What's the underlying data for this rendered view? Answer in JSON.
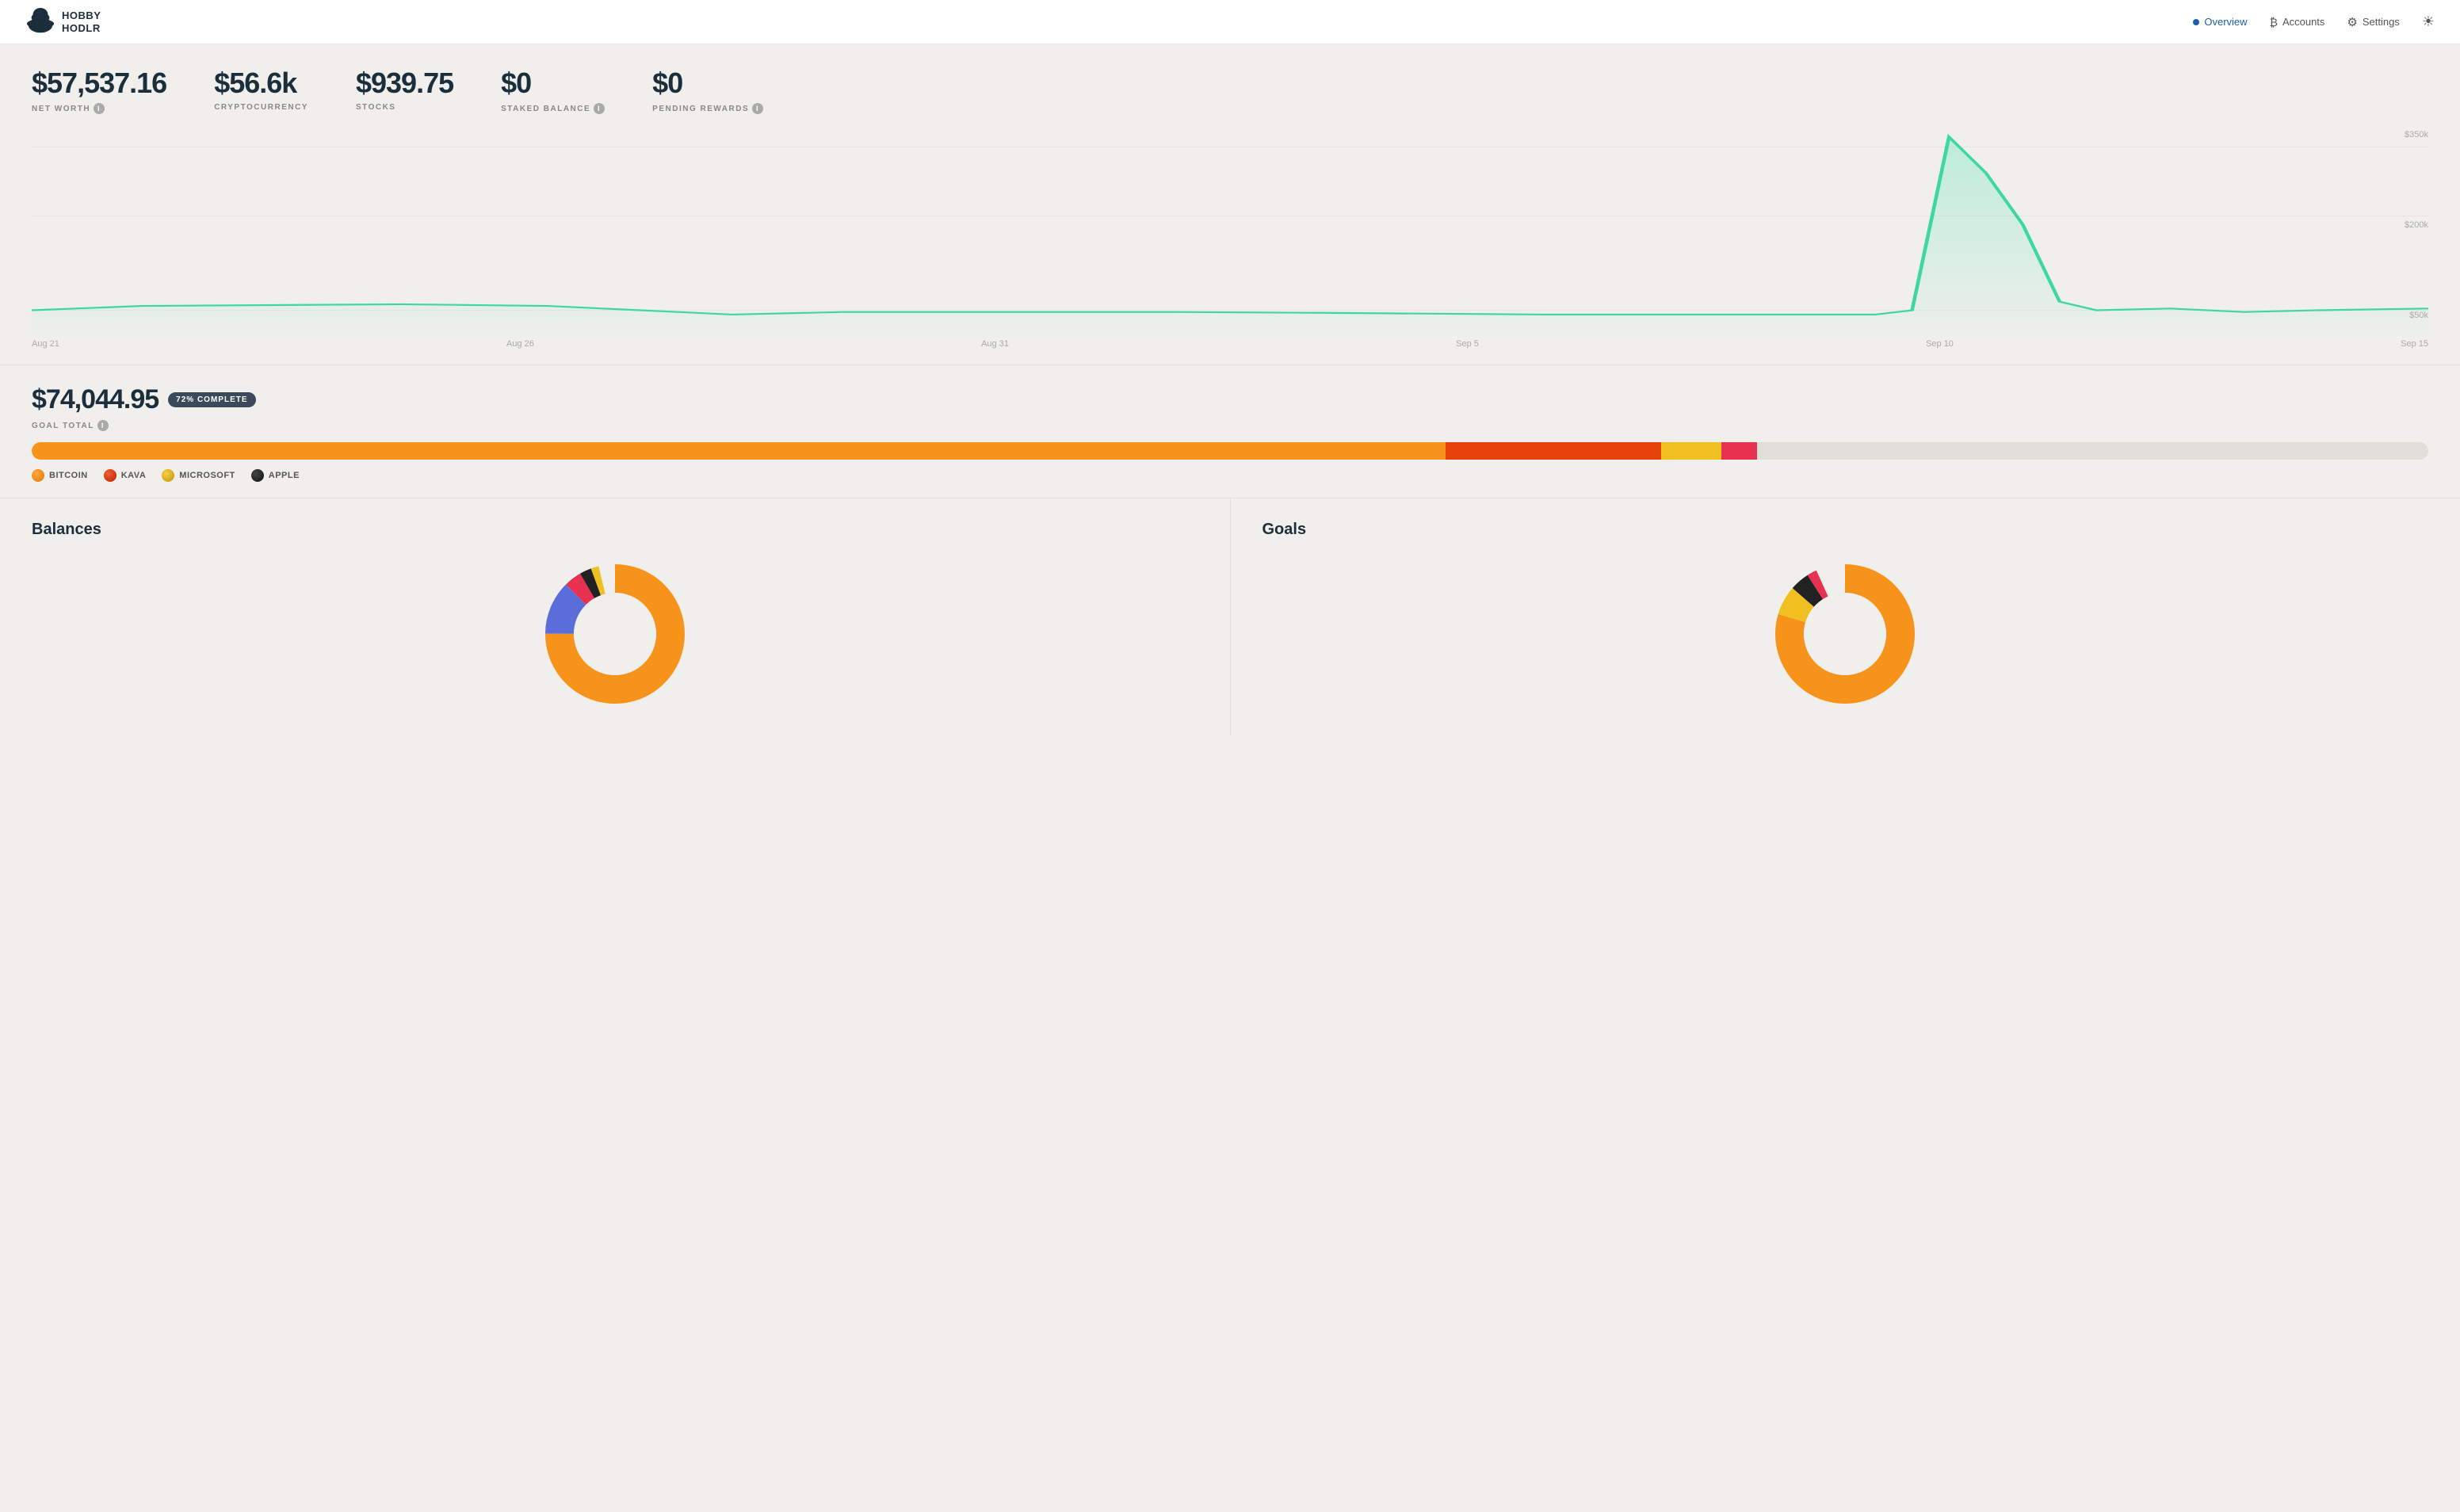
{
  "app": {
    "name_line1": "HOBBY",
    "name_line2": "HODLR"
  },
  "nav": {
    "links": [
      {
        "id": "overview",
        "label": "Overview",
        "active": true,
        "icon": "circle-dot"
      },
      {
        "id": "accounts",
        "label": "Accounts",
        "active": false,
        "icon": "bitcoin"
      },
      {
        "id": "settings",
        "label": "Settings",
        "active": false,
        "icon": "gear"
      }
    ],
    "theme_icon": "sun"
  },
  "stats": {
    "net_worth": {
      "value": "$57,537.16",
      "label": "NET WORTH",
      "has_info": true
    },
    "cryptocurrency": {
      "value": "$56.6k",
      "label": "CRYPTOCURRENCY",
      "has_info": false
    },
    "stocks": {
      "value": "$939.75",
      "label": "STOCKS",
      "has_info": false
    },
    "staked_balance": {
      "value": "$0",
      "label": "STAKED BALANCE",
      "has_info": true
    },
    "pending_rewards": {
      "value": "$0",
      "label": "PENDING REWARDS",
      "has_info": true
    }
  },
  "chart": {
    "x_labels": [
      "Aug 21",
      "Aug 26",
      "Aug 31",
      "Sep 5",
      "Sep 10",
      "Sep 15"
    ],
    "y_labels": [
      "$350k",
      "$200k",
      "$50k"
    ],
    "peak_date": "Sep 10"
  },
  "goal": {
    "amount": "$74,044.95",
    "badge": "72% COMPLETE",
    "label": "GOAL TOTAL",
    "has_info": true,
    "bar_segments": [
      {
        "id": "bitcoin",
        "pct": 58,
        "color": "#f7931a"
      },
      {
        "id": "kava",
        "pct": 10,
        "color": "#e8420c"
      },
      {
        "id": "microsoft",
        "pct": 3,
        "color": "#f0c020"
      },
      {
        "id": "apple",
        "pct": 1,
        "color": "#e83050"
      }
    ],
    "legend": [
      {
        "id": "bitcoin",
        "label": "BITCOIN",
        "dot_class": "legend-dot-bitcoin"
      },
      {
        "id": "kava",
        "label": "KAVA",
        "dot_class": "legend-dot-kava"
      },
      {
        "id": "microsoft",
        "label": "MICROSOFT",
        "dot_class": "legend-dot-microsoft"
      },
      {
        "id": "apple",
        "label": "APPLE",
        "dot_class": "legend-dot-apple"
      }
    ]
  },
  "balances": {
    "title": "Balances"
  },
  "goals_panel": {
    "title": "Goals"
  }
}
